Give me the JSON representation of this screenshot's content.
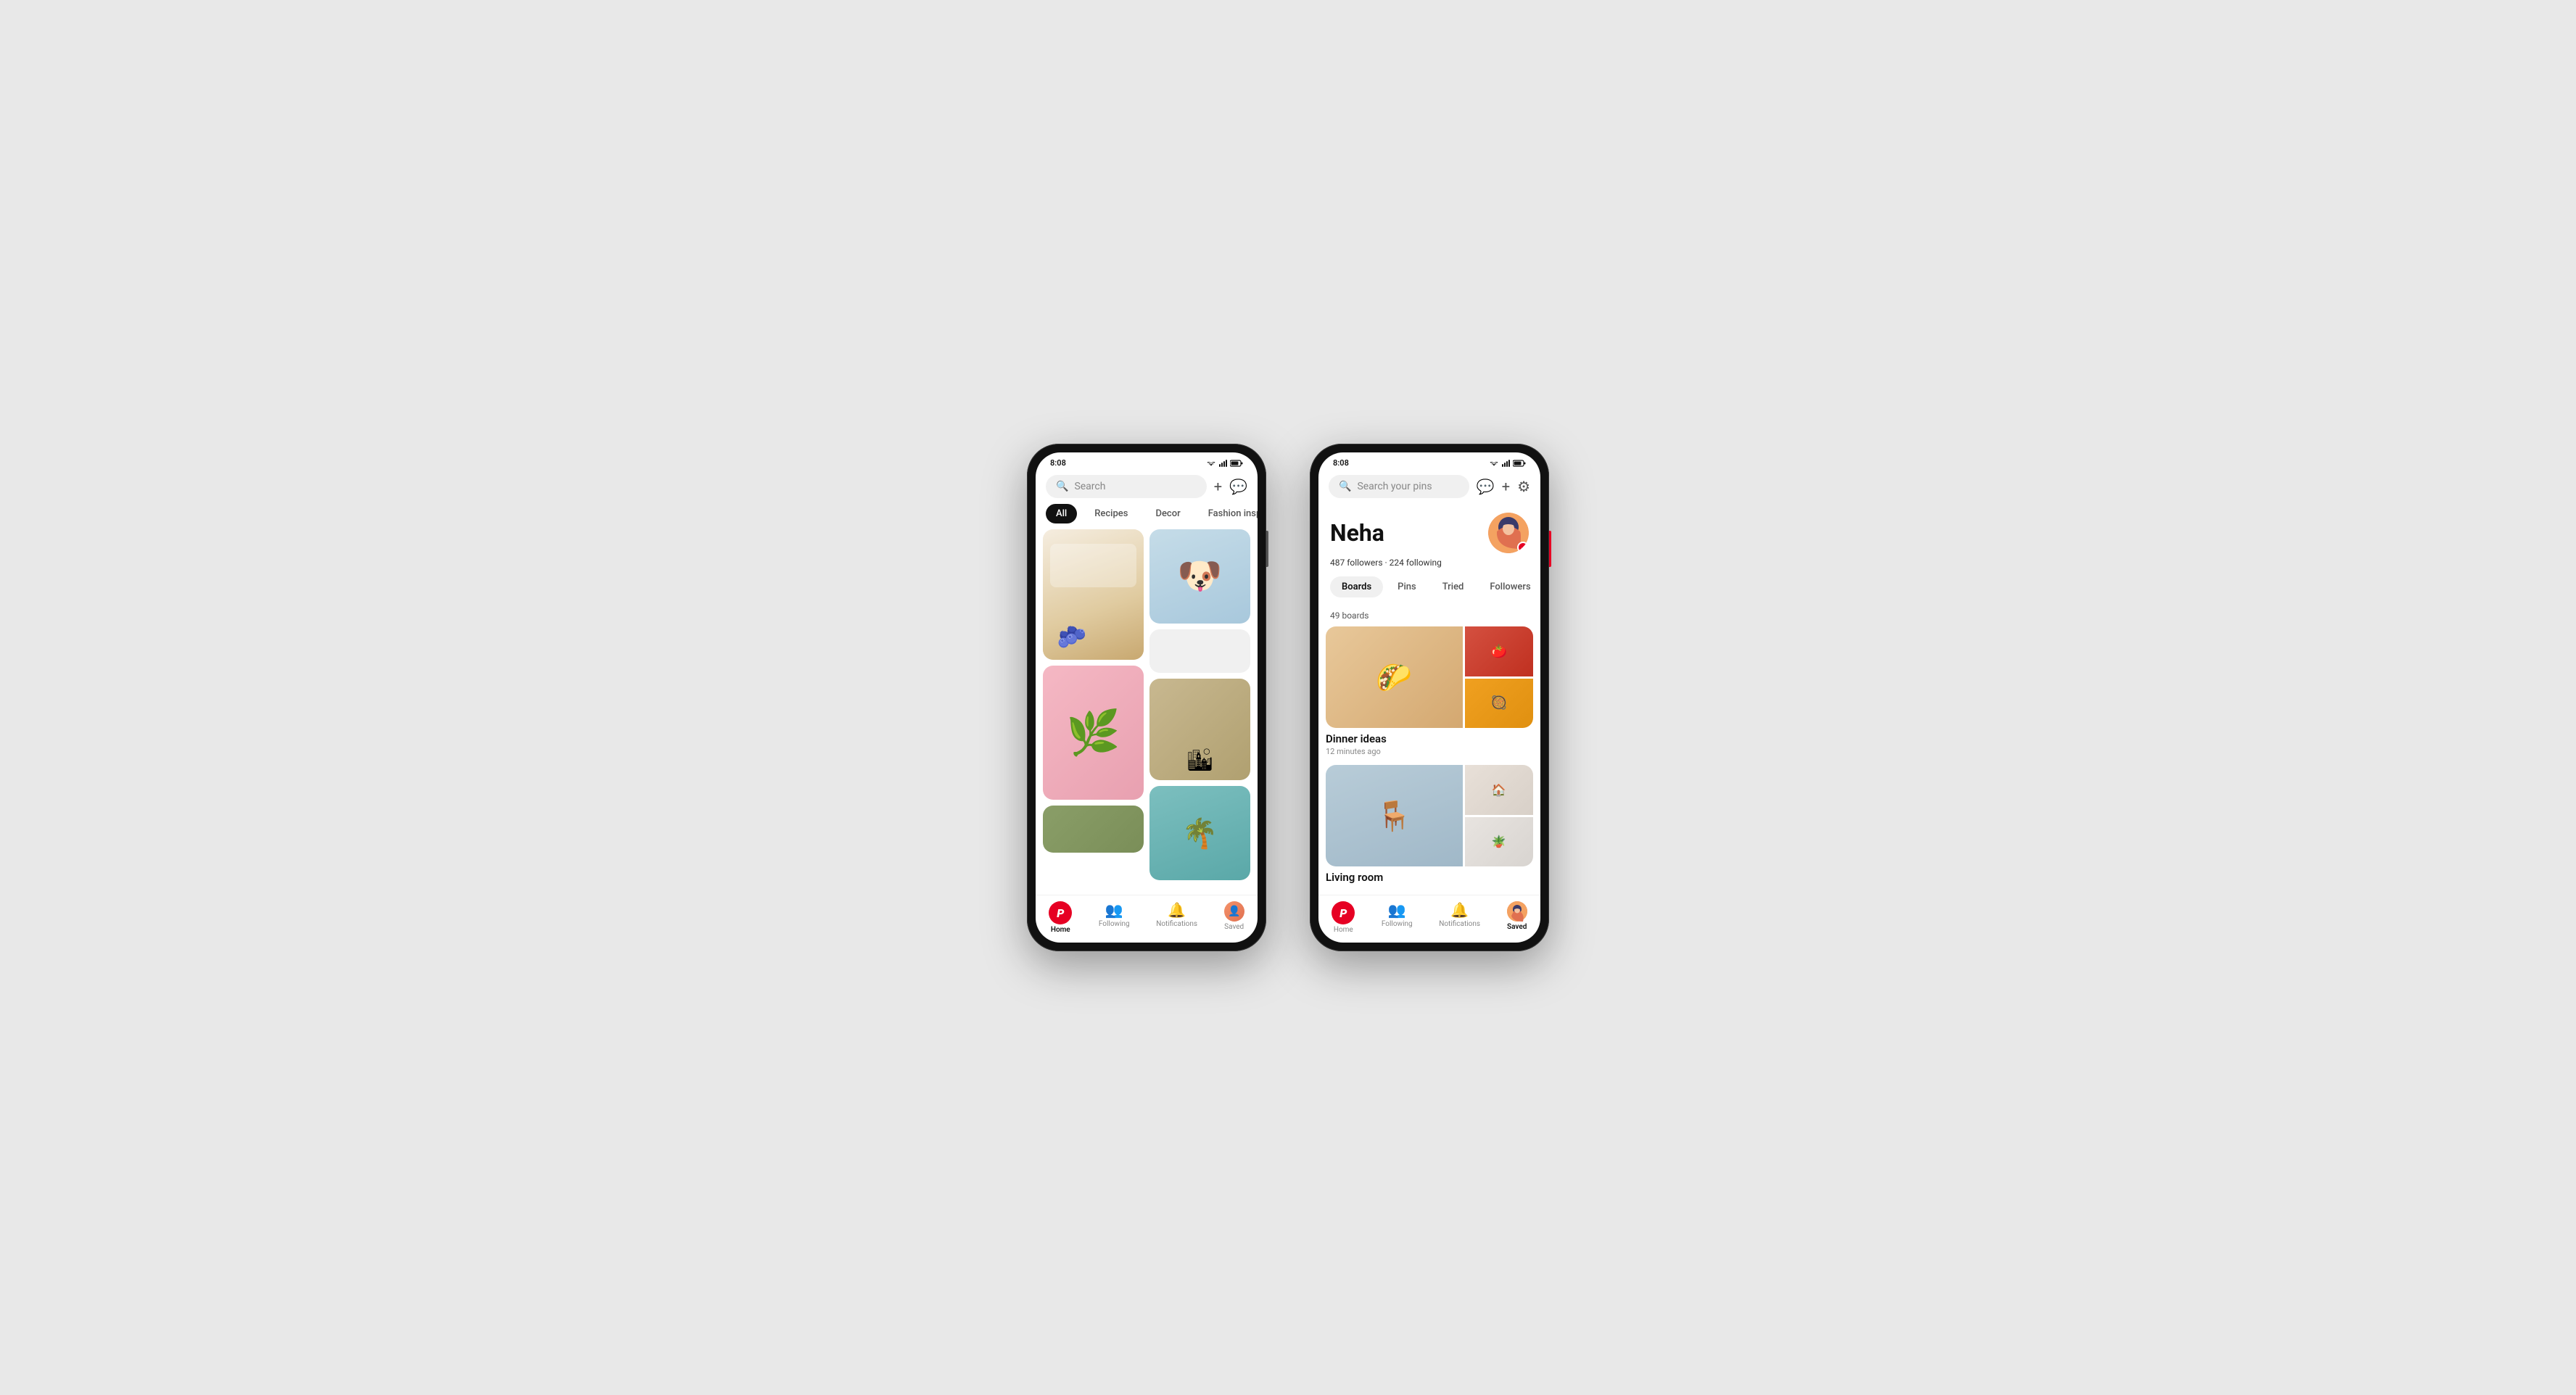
{
  "phone1": {
    "status": {
      "time": "8:08"
    },
    "search": {
      "placeholder": "Search"
    },
    "filters": [
      {
        "label": "All",
        "active": true
      },
      {
        "label": "Recipes",
        "active": false
      },
      {
        "label": "Decor",
        "active": false
      },
      {
        "label": "Fashion insp...",
        "active": false
      }
    ],
    "nav": [
      {
        "label": "Home",
        "active": true,
        "icon": "home"
      },
      {
        "label": "Following",
        "active": false,
        "icon": "people"
      },
      {
        "label": "Notifications",
        "active": false,
        "icon": "bell"
      },
      {
        "label": "Saved",
        "active": false,
        "icon": "person"
      }
    ]
  },
  "phone2": {
    "status": {
      "time": "8:08"
    },
    "search": {
      "placeholder": "Search your pins"
    },
    "profile": {
      "name": "Neha",
      "followers": "487 followers",
      "following": "224 following",
      "stats_separator": "·",
      "boards_count": "49 boards",
      "board1_title": "Dinner ideas",
      "board1_time": "12 minutes ago",
      "board2_title": "Living room",
      "board2_time": ""
    },
    "profile_tabs": [
      {
        "label": "Boards",
        "active": true
      },
      {
        "label": "Pins",
        "active": false
      },
      {
        "label": "Tried",
        "active": false
      },
      {
        "label": "Followers",
        "active": false
      }
    ],
    "nav": [
      {
        "label": "Home",
        "active": false,
        "icon": "home"
      },
      {
        "label": "Following",
        "active": false,
        "icon": "people"
      },
      {
        "label": "Notifications",
        "active": false,
        "icon": "bell"
      },
      {
        "label": "Saved",
        "active": true,
        "icon": "person"
      }
    ]
  },
  "icons": {
    "pinterest_p": "P",
    "search": "🔍",
    "plus": "+",
    "message": "💬",
    "settings": "⚙",
    "home": "⌂",
    "people": "👥",
    "bell": "🔔",
    "person": "👤",
    "check": "✓"
  }
}
